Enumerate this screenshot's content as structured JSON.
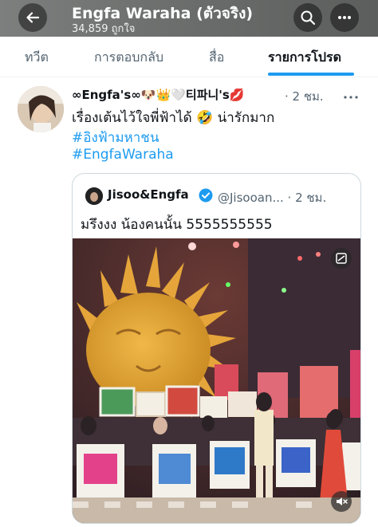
{
  "header": {
    "title": "Engfa Waraha (ตัวจริง)",
    "subtitle": "34,859 ถูกใจ"
  },
  "tabs": [
    {
      "label": "ทวีต",
      "active": false
    },
    {
      "label": "การตอบกลับ",
      "active": false
    },
    {
      "label": "สื่อ",
      "active": false
    },
    {
      "label": "รายการโปรด",
      "active": true
    }
  ],
  "tweet": {
    "author_prefix": "∞Engfa's∞",
    "author_suffix": "티파니's",
    "time": "· 2 ชม.",
    "text": "เรื่องเต้นไว้ใจพี่ฟ้าได้ 🤣 น่ารักมาก",
    "hashtags": [
      "#อิงฟ้ามหาชน",
      "#EngfaWaraha"
    ]
  },
  "quoted": {
    "name": "Jisoo&Engfa",
    "handle": "@Jisooan... · 2 ชม.",
    "text": "มรึงงง น้องคนนั้น 5555555555"
  },
  "colors": {
    "accent": "#1d9bf0",
    "text": "#0f1419",
    "secondary": "#536471"
  }
}
